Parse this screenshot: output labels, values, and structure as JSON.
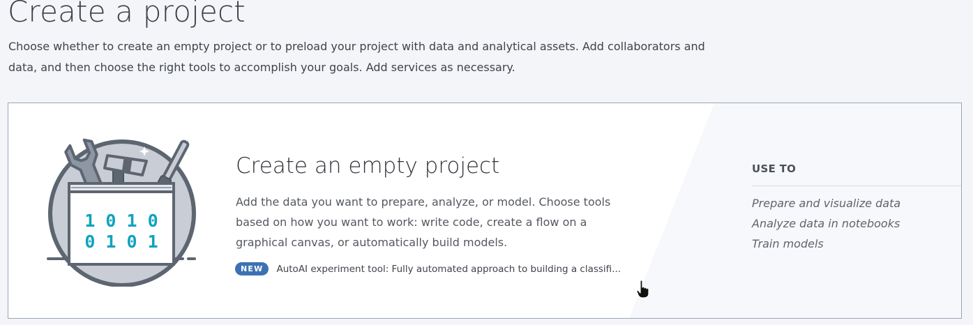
{
  "header": {
    "title": "Create a project",
    "description": "Choose whether to create an empty project or to preload your project with data and analytical assets. Add collaborators and data, and then choose the right tools to accomplish your goals. Add services as necessary."
  },
  "card": {
    "title": "Create an empty project",
    "description": "Add the data you want to prepare, analyze, or model. Choose tools based on how you want to work: write code, create a flow on a graphical canvas, or automatically build models.",
    "badge": "NEW",
    "new_feature_text": "AutoAI experiment tool: Fully automated approach to building a classifi...",
    "illustration": {
      "binary_line_1": "1 0 1 0",
      "binary_line_2": "0 1 0 1"
    },
    "use_to": {
      "title": "USE TO",
      "items": [
        "Prepare and visualize data",
        "Analyze data in notebooks",
        "Train models"
      ]
    }
  },
  "colors": {
    "page_background": "#f3f5f9",
    "card_background": "#ffffff",
    "card_border": "#9aa4b6",
    "badge_background": "#3e71b3",
    "illustration_circle": "#c9ced6",
    "illustration_outline": "#5d6670",
    "illustration_digits": "#0fa3bf"
  },
  "icons": {
    "illustration": "toolbox-wrench-hammer-screwdriver-icon",
    "cursor": "hand-pointer-cursor-icon"
  }
}
